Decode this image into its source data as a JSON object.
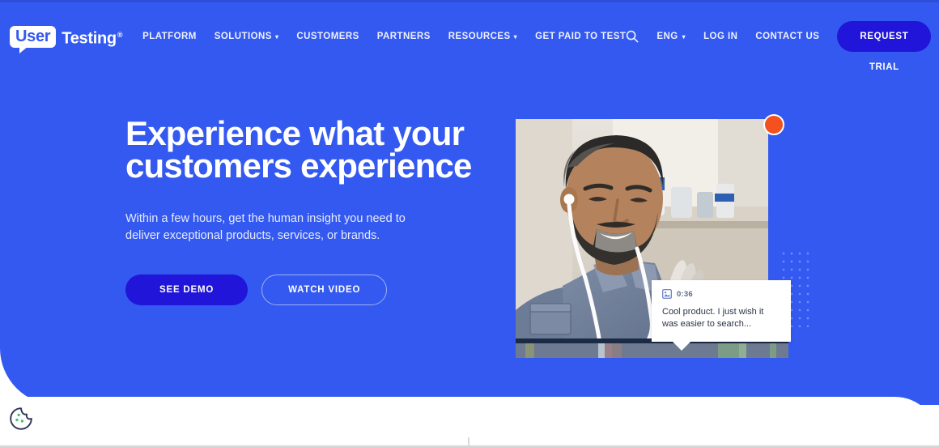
{
  "theme": {
    "hero_blue": "#3359f0",
    "deep_blue": "#2015d8",
    "white": "#ffffff",
    "record_red": "#f4511e",
    "dot_grid_blue": "#6d8bf7",
    "timeline_gray": "#6d7a91",
    "timeline_dark": "#1c2b45"
  },
  "header": {
    "logo": {
      "bubble_text": "User",
      "word_text": "Testing",
      "trademark": "®",
      "icon": "speech-bubble-logo"
    },
    "nav": [
      {
        "label": "PLATFORM",
        "has_caret": false
      },
      {
        "label": "SOLUTIONS",
        "has_caret": true,
        "caret": "▾"
      },
      {
        "label": "CUSTOMERS",
        "has_caret": false
      },
      {
        "label": "PARTNERS",
        "has_caret": false
      },
      {
        "label": "RESOURCES",
        "has_caret": true,
        "caret": "▾"
      },
      {
        "label": "GET PAID TO TEST",
        "has_caret": false
      }
    ],
    "utility": {
      "search_icon": "search-icon",
      "language_label": "ENG",
      "language_caret": "▾",
      "login_label": "LOG IN",
      "contact_label": "CONTACT US",
      "request_trial_label": "REQUEST TRIAL"
    }
  },
  "hero": {
    "headline": "Experience what your\ncustomers experience",
    "subhead": "Within a few hours, get the human insight you need to\ndeliver exceptional products, services, or brands.",
    "primary_cta": "SEE DEMO",
    "secondary_cta": "WATCH VIDEO"
  },
  "video_card": {
    "record_indicator": "record-dot",
    "photo_alt": "bearded man wearing white earbuds smiling at camera",
    "tooltip": {
      "icon": "image-thumbnail-icon",
      "timestamp": "0:36",
      "text": "Cool product. I just wish it\nwas easier to search..."
    },
    "timeline_segments": [
      {
        "width": 4,
        "color": "#6d7a91"
      },
      {
        "width": 4,
        "color": "#8a9375"
      },
      {
        "width": 27,
        "color": "#6d7a91"
      },
      {
        "width": 3,
        "color": "#b7c3cf"
      },
      {
        "width": 3,
        "color": "#9a8187"
      },
      {
        "width": 4,
        "color": "#8a7d85"
      },
      {
        "width": 41,
        "color": "#6d7a91"
      },
      {
        "width": 9,
        "color": "#7d9c86"
      },
      {
        "width": 3,
        "color": "#8fae96"
      },
      {
        "width": 10,
        "color": "#6d7a91"
      },
      {
        "width": 3,
        "color": "#7d9c86"
      },
      {
        "width": 5,
        "color": "#6d7a91"
      }
    ]
  },
  "footer": {
    "cookie_icon": "cookie-consent-icon"
  }
}
